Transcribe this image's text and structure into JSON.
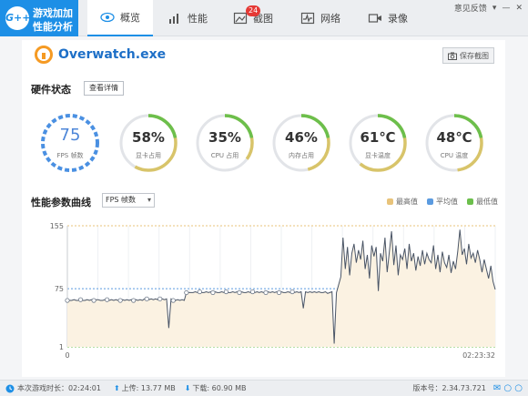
{
  "brand": {
    "logo": "G++",
    "line1": "游戏加加",
    "line2": "性能分析"
  },
  "tabs": [
    {
      "label": "概览",
      "icon": "eye-icon",
      "active": true
    },
    {
      "label": "性能",
      "icon": "bar-chart-icon",
      "active": false
    },
    {
      "label": "截图",
      "icon": "image-icon",
      "active": false,
      "badge": "24"
    },
    {
      "label": "网络",
      "icon": "network-pulse-icon",
      "active": false
    },
    {
      "label": "录像",
      "icon": "video-icon",
      "active": false
    }
  ],
  "window": {
    "feedback": "意见反馈"
  },
  "app": {
    "name": "Overwatch.exe",
    "snapshot_label": "保存截图"
  },
  "hardware": {
    "title": "硬件状态",
    "detail_button": "查看详情",
    "gauges": [
      {
        "value": "75",
        "label": "FPS 帧数",
        "fraction": 1.0,
        "color": "#4a90e2"
      },
      {
        "value": "58%",
        "label": "显卡占用",
        "fraction": 0.58,
        "color": "#6cbf4c"
      },
      {
        "value": "35%",
        "label": "CPU 占用",
        "fraction": 0.35,
        "color": "#6cbf4c"
      },
      {
        "value": "46%",
        "label": "内存占用",
        "fraction": 0.46,
        "color": "#6cbf4c"
      },
      {
        "value": "61℃",
        "label": "显卡温度",
        "fraction": 0.61,
        "color": "#6cbf4c"
      },
      {
        "value": "48℃",
        "label": "CPU 温度",
        "fraction": 0.48,
        "color": "#6cbf4c"
      }
    ]
  },
  "curve": {
    "title": "性能参数曲线",
    "selector": "FPS 帧数",
    "legend": [
      {
        "label": "最高值",
        "color": "#e8c37a"
      },
      {
        "label": "平均值",
        "color": "#5b9be0"
      },
      {
        "label": "最低值",
        "color": "#6cbf4c"
      }
    ]
  },
  "chart_data": {
    "type": "line",
    "y_ticks": [
      "155",
      "75",
      "1"
    ],
    "ylim": [
      1,
      155
    ],
    "x_start_label": "0",
    "x_end_label": "02:23:32",
    "reference_lines": {
      "max": 155,
      "avg": 75,
      "min": 1
    },
    "series": [
      {
        "values": [
          60,
          60,
          60,
          61,
          60,
          60,
          61,
          60,
          60,
          61,
          60,
          61,
          60,
          61,
          61,
          60,
          60,
          61,
          61,
          60,
          61,
          60,
          61,
          60,
          60,
          61,
          60,
          61,
          60,
          61,
          60,
          61,
          60,
          61,
          60,
          62,
          62,
          61,
          62,
          61,
          62,
          61,
          62,
          62,
          61,
          62,
          25,
          62,
          60,
          60,
          61,
          60,
          61,
          60,
          70,
          70,
          70,
          70,
          71,
          70,
          71,
          70,
          70,
          71,
          70,
          71,
          70,
          71,
          70,
          70,
          71,
          70,
          71,
          70,
          70,
          71,
          70,
          71,
          70,
          71,
          70,
          70,
          71,
          70,
          71,
          70,
          71,
          70,
          71,
          70,
          70,
          71,
          70,
          71,
          70,
          71,
          70,
          71,
          70,
          70,
          71,
          70,
          71,
          70,
          71,
          70,
          71,
          50,
          71,
          70,
          71,
          70,
          71,
          70,
          71,
          70,
          70,
          71,
          69,
          70,
          71,
          5,
          70,
          80,
          90,
          140,
          100,
          128,
          92,
          120,
          132,
          108,
          124,
          112,
          136,
          100,
          118,
          88,
          130,
          116,
          128,
          72,
          120,
          110,
          140,
          96,
          122,
          148,
          105,
          130,
          92,
          118,
          112,
          126,
          100,
          132,
          110,
          120,
          98,
          116,
          104,
          124,
          106,
          120,
          112,
          108,
          130,
          100,
          118,
          96,
          122,
          108,
          102,
          118,
          95,
          110,
          100,
          122,
          150,
          118,
          126,
          106,
          132,
          114,
          120,
          108,
          124,
          112,
          96,
          112,
          100,
          88,
          104,
          84,
          74
        ]
      }
    ]
  },
  "status": {
    "session_label": "本次游戏时长：02:24:01",
    "upload": "上传: 13.77 MB",
    "download": "下载: 60.90 MB",
    "version": "版本号：2.34.73.721"
  }
}
